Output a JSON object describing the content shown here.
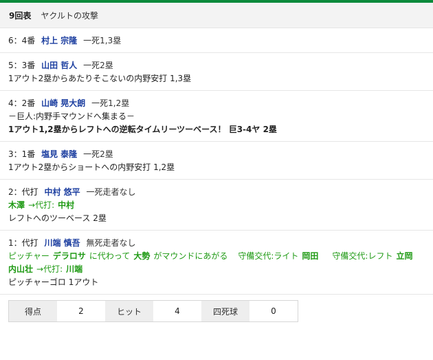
{
  "inning": {
    "label": "9回表",
    "attacker": "ヤクルトの攻撃"
  },
  "plays": [
    {
      "prefix": "6：4番",
      "player": "村上 宗隆",
      "situation": "一死1,3塁",
      "lines": []
    },
    {
      "prefix": "5：3番",
      "player": "山田 哲人",
      "situation": "一死2塁",
      "lines": [
        "1アウト2塁からあたりそこないの内野安打 1,3塁"
      ]
    },
    {
      "prefix": "4：2番",
      "player": "山崎 晃大朗",
      "situation": "一死1,2塁",
      "lines": [
        "－巨人:内野手マウンドへ集まる－"
      ],
      "bold_line": "1アウト1,2塁からレフトへの逆転タイムリーツーベース！ 巨3-4ヤ 2塁"
    },
    {
      "prefix": "3：1番",
      "player": "塩見 泰隆",
      "situation": "一死2塁",
      "lines": [
        "1アウト2塁からショートへの内野安打 1,2塁"
      ]
    },
    {
      "prefix": "2：代打",
      "player": "中村 悠平",
      "situation": "一死走者なし",
      "sub": {
        "name": "木澤",
        "arrow": "→代打:",
        "to": "中村"
      },
      "lines": [
        "レフトへのツーベース 2塁"
      ]
    },
    {
      "prefix": "1：代打",
      "player": "川端 慎吾",
      "situation": "無死走者なし",
      "green": {
        "pitcher_label": "ピッチャー",
        "out": "デラロサ",
        "mid": "に代わって",
        "in": "大勢",
        "tail": "がマウンドにあがる",
        "def1_label": "守備交代:ライト",
        "def1_name": "岡田",
        "def2_label": "守備交代:レフト",
        "def2_name": "立岡"
      },
      "sub": {
        "name": "内山壮",
        "arrow": "→代打:",
        "to": "川端"
      },
      "lines": [
        "ピッチャーゴロ 1アウト"
      ]
    }
  ],
  "summary": {
    "runs_label": "得点",
    "runs": "2",
    "hits_label": "ヒット",
    "hits": "4",
    "bb_label": "四死球",
    "bb": "0"
  }
}
